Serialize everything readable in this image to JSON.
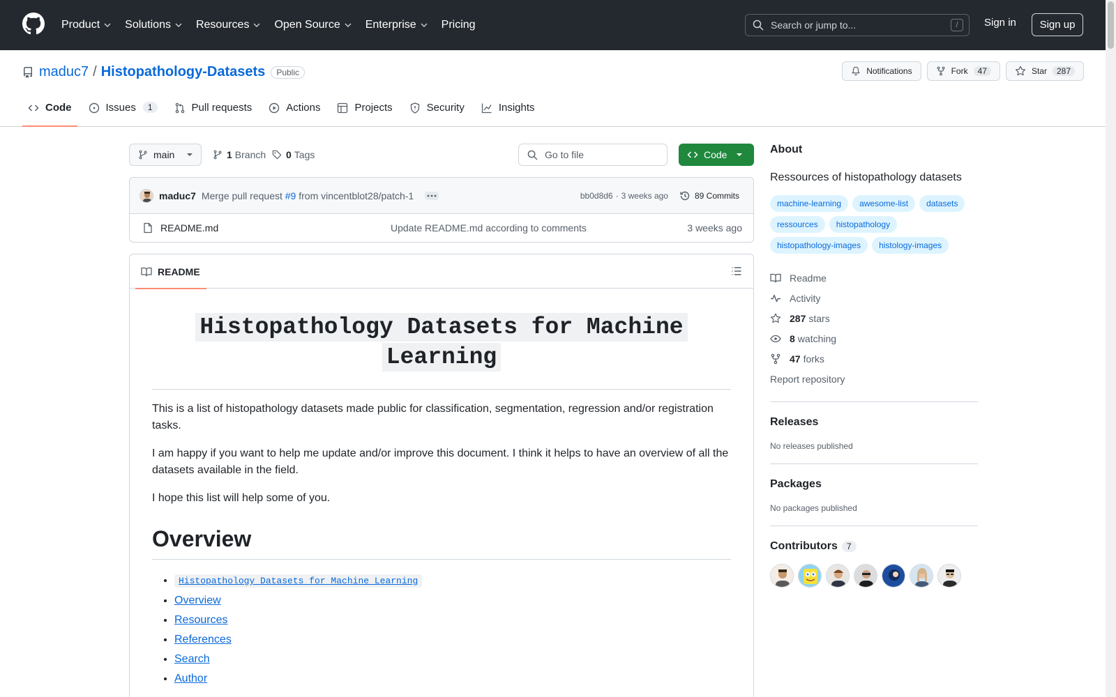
{
  "topnav": {
    "items": [
      {
        "label": "Product",
        "dropdown": true
      },
      {
        "label": "Solutions",
        "dropdown": true
      },
      {
        "label": "Resources",
        "dropdown": true
      },
      {
        "label": "Open Source",
        "dropdown": true
      },
      {
        "label": "Enterprise",
        "dropdown": true
      },
      {
        "label": "Pricing",
        "dropdown": false
      }
    ],
    "search_placeholder": "Search or jump to...",
    "search_shortcut": "/",
    "signin": "Sign in",
    "signup": "Sign up"
  },
  "repo": {
    "owner": "maduc7",
    "separator": "/",
    "name": "Histopathology-Datasets",
    "visibility": "Public",
    "notifications": "Notifications",
    "fork_label": "Fork",
    "fork_count": "47",
    "star_label": "Star",
    "star_count": "287"
  },
  "tabs": [
    {
      "label": "Code",
      "icon": "code-icon",
      "active": true
    },
    {
      "label": "Issues",
      "icon": "issue-icon",
      "count": "1"
    },
    {
      "label": "Pull requests",
      "icon": "pull-request-icon"
    },
    {
      "label": "Actions",
      "icon": "play-icon"
    },
    {
      "label": "Projects",
      "icon": "table-icon"
    },
    {
      "label": "Security",
      "icon": "shield-icon"
    },
    {
      "label": "Insights",
      "icon": "graph-icon"
    }
  ],
  "branchbar": {
    "branch": "main",
    "branches_count": "1",
    "branches_label": "Branch",
    "tags_count": "0",
    "tags_label": "Tags",
    "goto_placeholder": "Go to file",
    "code_button": "Code"
  },
  "commit": {
    "author": "maduc7",
    "message_prefix": "Merge pull request",
    "pr_ref": "#9",
    "message_suffix": "from vincentblot28/patch-1",
    "sha": "bb0d8d6",
    "dot": "·",
    "time": "3 weeks ago",
    "commits_count": "89 Commits"
  },
  "files": [
    {
      "name": "README.md",
      "message": "Update README.md according to comments",
      "time": "3 weeks ago"
    }
  ],
  "readme": {
    "tab_label": "README",
    "title_line1": "Histopathology Datasets for Machine",
    "title_line2": "Learning",
    "paragraphs": [
      "This is a list of histopathology datasets made public for classification, segmentation, regression and/or registration tasks.",
      "I am happy if you want to help me update and/or improve this document. I think it helps to have an overview of all the datasets available in the field.",
      "I hope this list will help some of you."
    ],
    "overview_heading": "Overview",
    "toc": [
      "Histopathology Datasets for Machine Learning",
      "Overview",
      "Resources",
      "References",
      "Search",
      "Author"
    ]
  },
  "sidebar": {
    "about_title": "About",
    "description": "Ressources of histopathology datasets",
    "topics": [
      "machine-learning",
      "awesome-list",
      "datasets",
      "ressources",
      "histopathology",
      "histopathology-images",
      "histology-images"
    ],
    "links": {
      "readme": "Readme",
      "activity": "Activity",
      "stars_count": "287",
      "stars_label": "stars",
      "watching_count": "8",
      "watching_label": "watching",
      "forks_count": "47",
      "forks_label": "forks",
      "report": "Report repository"
    },
    "releases_title": "Releases",
    "releases_text": "No releases published",
    "packages_title": "Packages",
    "packages_text": "No packages published",
    "contributors_title": "Contributors",
    "contributors_count": "7"
  },
  "colors": {
    "header_bg": "#24292f",
    "link": "#0969da",
    "primary_button": "#1f883d",
    "active_tab_underline": "#fd8c73",
    "topic_bg": "#ddf4ff"
  }
}
